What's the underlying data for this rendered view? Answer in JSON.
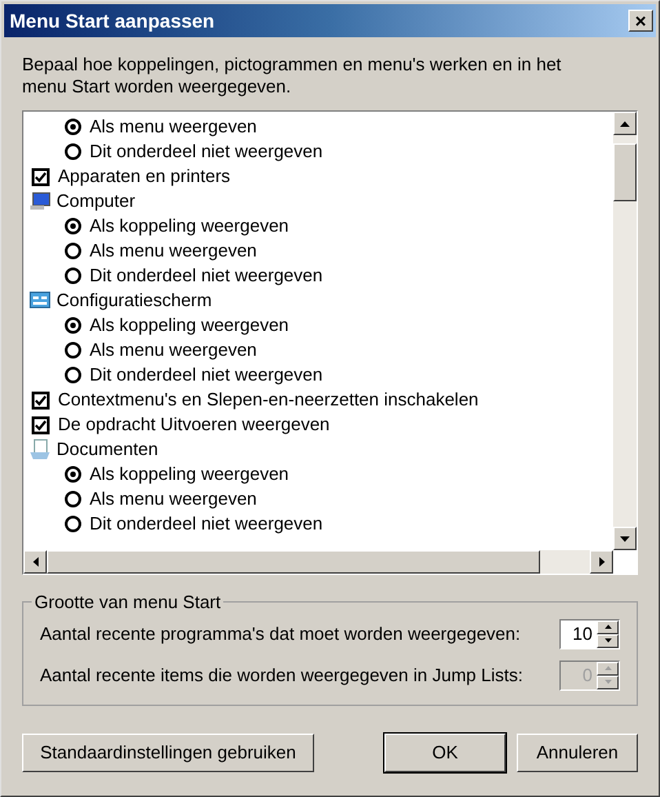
{
  "window": {
    "title": "Menu Start aanpassen",
    "close": "×"
  },
  "description": "Bepaal hoe koppelingen, pictogrammen en menu's werken en in het menu Start worden weergegeven.",
  "items": [
    {
      "kind": "options",
      "options": [
        {
          "label": "Als menu weergeven",
          "selected": true
        },
        {
          "label": "Dit onderdeel niet weergeven",
          "selected": false
        }
      ]
    },
    {
      "kind": "checkbox",
      "label": "Apparaten en printers",
      "checked": true
    },
    {
      "kind": "heading",
      "label": "Computer",
      "options": [
        {
          "label": "Als koppeling weergeven",
          "selected": true
        },
        {
          "label": "Als menu weergeven",
          "selected": false
        },
        {
          "label": "Dit onderdeel niet weergeven",
          "selected": false
        }
      ]
    },
    {
      "kind": "heading",
      "label": "Configuratiescherm",
      "options": [
        {
          "label": "Als koppeling weergeven",
          "selected": true
        },
        {
          "label": "Als menu weergeven",
          "selected": false
        },
        {
          "label": "Dit onderdeel niet weergeven",
          "selected": false
        }
      ]
    },
    {
      "kind": "checkbox",
      "label": "Contextmenu's en Slepen-en-neerzetten inschakelen",
      "checked": true
    },
    {
      "kind": "checkbox",
      "label": "De opdracht Uitvoeren weergeven",
      "checked": true
    },
    {
      "kind": "heading",
      "label": "Documenten",
      "options": [
        {
          "label": "Als koppeling weergeven",
          "selected": true
        },
        {
          "label": "Als menu weergeven",
          "selected": false
        },
        {
          "label": "Dit onderdeel niet weergeven",
          "selected": false
        }
      ]
    }
  ],
  "group": {
    "title": "Grootte van menu Start",
    "fields": [
      {
        "label": "Aantal recente programma's dat moet worden weergegeven:",
        "value": "10",
        "disabled": false
      },
      {
        "label": "Aantal recente items die worden weergegeven in Jump Lists:",
        "value": "0",
        "disabled": true
      }
    ]
  },
  "buttons": [
    {
      "label": "Standaardinstellingen gebruiken",
      "default": false
    },
    {
      "label": "OK",
      "default": true
    },
    {
      "label": "Annuleren",
      "default": false
    }
  ]
}
